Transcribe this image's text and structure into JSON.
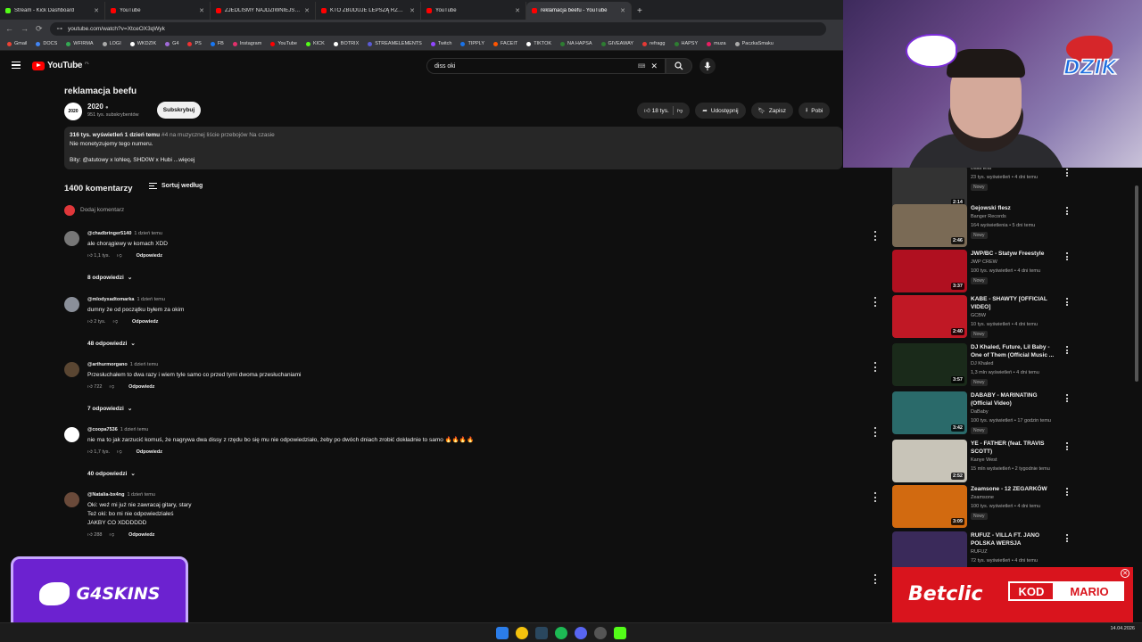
{
  "tabs": [
    {
      "label": "Stream - Kick Dashboard",
      "color": "#53fc18"
    },
    {
      "label": "YouTube",
      "color": "#ff0000"
    },
    {
      "label": "ZJEDLIŚMY NAJDZIWNIEJSZĄ...",
      "color": "#ff0000"
    },
    {
      "label": "KTO ZBUDUJE LEPSZĄ RZECZ",
      "color": "#ff0000"
    },
    {
      "label": "YouTube",
      "color": "#ff0000"
    },
    {
      "label": "reklamacja beefu - YouTube",
      "color": "#ff0000"
    }
  ],
  "url": "youtube.com/watch?v=XtceOX3qWyk",
  "bookmarks": [
    "Gmail",
    "DOCS",
    "WFIRMA",
    "LOGI",
    "WKDZIK",
    "G4",
    "PS",
    "FB",
    "Instagram",
    "YouTube",
    "KICK",
    "BOTRIX",
    "STREAMELEMENTS",
    "Twitch",
    "TIPPLY",
    "FACEIT",
    "TIKTOK",
    "NA HAPSA",
    "GIVEAWAY",
    "refragg",
    "HAPSY",
    "muza",
    "PaczkaSmaku"
  ],
  "header": {
    "logo": "YouTube",
    "region": "PL",
    "search_value": "diss oki"
  },
  "video": {
    "title": "reklamacja beefu",
    "channel": "2020",
    "avatar_text": "2020",
    "subscribers": "951 tys. subskrybentów",
    "subscribe_label": "Subskrybuj",
    "likes": "18 tys.",
    "share_label": "Udostępnij",
    "save_label": "Zapisz",
    "download_label": "Pobi",
    "views_line": "316 tys. wyświetleń  1 dzień temu",
    "chart_line": "#4 na muzycznej liście przebojów Na czasie",
    "monetization": "Nie monetyzujemy tego numeru.",
    "beats": "Bity: @atutowy x lohleq, SHD0W x Hubi ...więcej"
  },
  "comments_section": {
    "count": "1400 komentarzy",
    "sort_label": "Sortuj według",
    "add_placeholder": "Dodaj komentarz"
  },
  "comments": [
    {
      "author": "@chadbringer5140",
      "time": "1 dzień temu",
      "text": "ale chorągiewy w komach XDD",
      "likes": "1,1 tys.",
      "reply": "Odpowiedz",
      "replies": "8 odpowiedzi",
      "avatar_color": "#777"
    },
    {
      "author": "@mlodyxadtomarka",
      "time": "1 dzień temu",
      "text": "dumny że od początku byłem za okim",
      "likes": "2 tys.",
      "reply": "Odpowiedz",
      "replies": "48 odpowiedzi",
      "avatar_color": "#8a8f99"
    },
    {
      "author": "@arthurmorgano",
      "time": "1 dzień temu",
      "text": "Przesłuchałem to dwa razy i wiem tyle samo co przed tymi dwoma przesłuchaniami",
      "likes": "722",
      "reply": "Odpowiedz",
      "replies": "7 odpowiedzi",
      "avatar_color": "#5a4632"
    },
    {
      "author": "@coopa7536",
      "time": "1 dzień temu",
      "text": "nie ma to jak zarzucić komuś, że nagrywa dwa dissy z rzędu bo się mu nie odpowiedziało, żeby po dwóch dniach zrobić dokładnie to samo 🔥🔥🔥🔥",
      "likes": "1,7 tys.",
      "reply": "Odpowiedz",
      "replies": "40 odpowiedzi",
      "avatar_color": "#ffffff"
    },
    {
      "author": "@Natalia-bx4ng",
      "time": "1 dzień temu",
      "text": "Oki: weź mi już nie zawracaj gitary, stary\nTeż oki: bo mi nie odpowiedziałeś\nJAKBY CO XDDDDDD",
      "likes": "288",
      "reply": "Odpowiedz",
      "replies": "",
      "avatar_color": "#6a4a3a"
    }
  ],
  "recommendations": [
    {
      "title": "",
      "channel": "Baila Ella",
      "meta": "23 tys. wyświetleń • 4 dni temu",
      "badge": "Nowy",
      "duration": "2:14",
      "thumb": "#333333"
    },
    {
      "title": "Gejowski flesz",
      "channel": "Banger Records",
      "meta": "164 wyświetlenia • 5 dni temu",
      "badge": "Nowy",
      "duration": "2:46",
      "thumb": "#7a6a55"
    },
    {
      "title": "JWP/BC - Statyw Freestyle",
      "channel": "JWP CREW",
      "meta": "100 tys. wyświetleń • 4 dni temu",
      "badge": "Nowy",
      "duration": "3:37",
      "thumb": "#b01020"
    },
    {
      "title": "KABE - SHAWTY [OFFICIAL VIDEO]",
      "channel": "GCBW",
      "meta": "10 tys. wyświetleń • 4 dni temu",
      "badge": "Nowy",
      "duration": "2:40",
      "thumb": "#c01825"
    },
    {
      "title": "DJ Khaled, Future, Lil Baby - One of Them (Official Music ...",
      "channel": "DJ Khaled",
      "meta": "1,3 mln wyświetleń • 4 dni temu",
      "badge": "Nowy",
      "duration": "3:57",
      "thumb": "#1a2a1a"
    },
    {
      "title": "DABABY - MARINATING (Official Video)",
      "channel": "DaBaby",
      "meta": "100 tys. wyświetleń • 17 godzin temu",
      "badge": "Nowy",
      "duration": "3:42",
      "thumb": "#2a6a6a"
    },
    {
      "title": "YE - FATHER (feat. TRAVIS SCOTT)",
      "channel": "Kanye West",
      "meta": "15 mln wyświetleń • 2 tygodnie temu",
      "badge": "",
      "duration": "2:52",
      "thumb": "#c8c4b8"
    },
    {
      "title": "Zeamsone - 12 ZEGARKÓW",
      "channel": "Zeamsone",
      "meta": "100 tys. wyświetleń • 4 dni temu",
      "badge": "Nowy",
      "duration": "3:09",
      "thumb": "#d26a10"
    },
    {
      "title": "RUFUZ - VILLA FT. JANO POLSKA WERSJA",
      "channel": "RUFUZ",
      "meta": "72 tys. wyświetleń • 4 dni temu",
      "badge": "",
      "duration": "",
      "thumb": "#3a2a5a"
    }
  ],
  "overlays": {
    "dzik": "DZIK",
    "g4skins": "G4SKINS",
    "betclic": "Betclic",
    "kod": "KOD",
    "code": "MARIO"
  },
  "taskbar": {
    "time": "",
    "date": "14.04.2026"
  }
}
